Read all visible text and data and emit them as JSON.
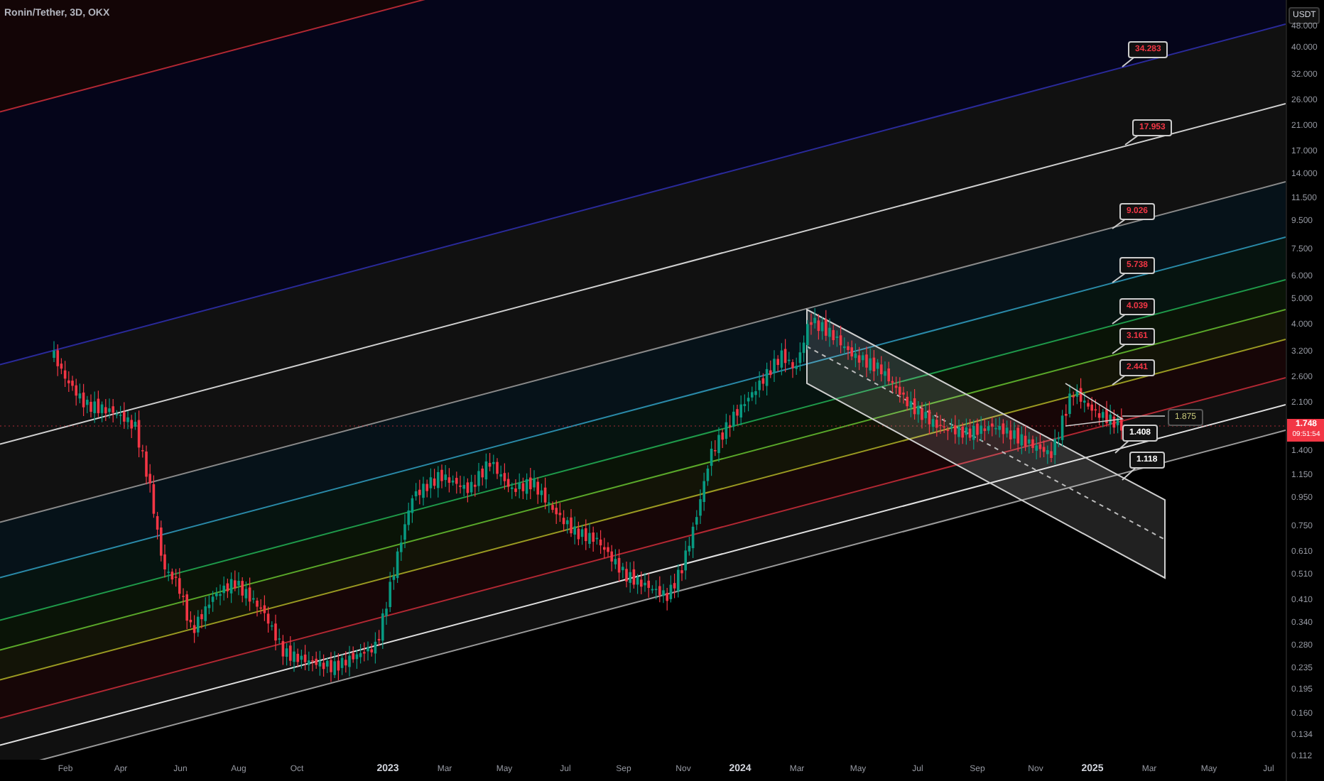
{
  "header": {
    "symbol": "Ronin/Tether, 3D, OKX"
  },
  "price_axis": {
    "currency": "USDT",
    "ticks": [
      "48.000",
      "40.000",
      "32.000",
      "26.000",
      "21.000",
      "17.000",
      "14.000",
      "11.500",
      "9.500",
      "7.500",
      "6.000",
      "5.000",
      "4.000",
      "3.200",
      "2.600",
      "2.100",
      "1.400",
      "1.150",
      "0.950",
      "0.750",
      "0.610",
      "0.510",
      "0.410",
      "0.340",
      "0.280",
      "0.235",
      "0.195",
      "0.160",
      "0.134",
      "0.112"
    ],
    "last_price": "1.748",
    "countdown": "09:51:54"
  },
  "time_axis": {
    "ticks": [
      {
        "label": "Feb",
        "major": false
      },
      {
        "label": "Apr",
        "major": false
      },
      {
        "label": "Jun",
        "major": false
      },
      {
        "label": "Aug",
        "major": false
      },
      {
        "label": "Oct",
        "major": false
      },
      {
        "label": "2023",
        "major": true
      },
      {
        "label": "Mar",
        "major": false
      },
      {
        "label": "May",
        "major": false
      },
      {
        "label": "Jul",
        "major": false
      },
      {
        "label": "Sep",
        "major": false
      },
      {
        "label": "Nov",
        "major": false
      },
      {
        "label": "2024",
        "major": true
      },
      {
        "label": "Mar",
        "major": false
      },
      {
        "label": "May",
        "major": false
      },
      {
        "label": "Jul",
        "major": false
      },
      {
        "label": "Sep",
        "major": false
      },
      {
        "label": "Nov",
        "major": false
      },
      {
        "label": "2025",
        "major": true
      },
      {
        "label": "Mar",
        "major": false
      },
      {
        "label": "May",
        "major": false
      },
      {
        "label": "Jul",
        "major": false
      }
    ]
  },
  "levels": [
    {
      "label": "34.283",
      "color": "#f23645"
    },
    {
      "label": "17.953",
      "color": "#f23645"
    },
    {
      "label": "9.026",
      "color": "#f23645"
    },
    {
      "label": "5.738",
      "color": "#f23645"
    },
    {
      "label": "4.039",
      "color": "#f23645"
    },
    {
      "label": "3.161",
      "color": "#f23645"
    },
    {
      "label": "2.441",
      "color": "#f23645"
    },
    {
      "label": "1.875",
      "color": "#c8c87a"
    },
    {
      "label": "1.408",
      "color": "#ffffff"
    },
    {
      "label": "1.118",
      "color": "#ffffff"
    }
  ]
}
